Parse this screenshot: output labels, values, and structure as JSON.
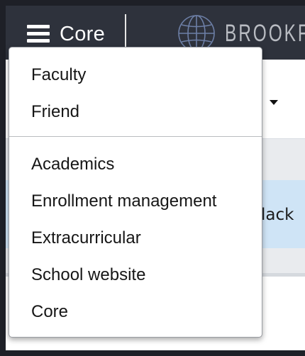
{
  "header": {
    "menu_button_label": "Core",
    "logo_text": "BROOKFI"
  },
  "background": {
    "partial_text": "lack"
  },
  "menu": {
    "group1": [
      "Faculty",
      "Friend"
    ],
    "group2": [
      "Academics",
      "Enrollment management",
      "Extracurricular",
      "School website",
      "Core"
    ]
  },
  "colors": {
    "topbar": "#2e323c",
    "highlight_row": "#cfe4f6",
    "menu_bg": "#ffffff"
  }
}
